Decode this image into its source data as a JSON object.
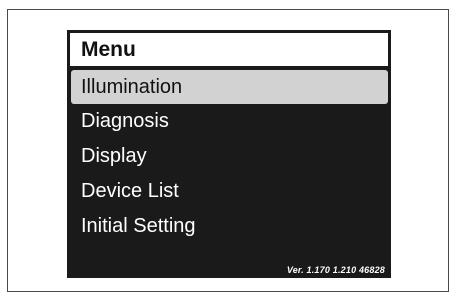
{
  "menu": {
    "title": "Menu",
    "items": [
      {
        "label": "Illumination",
        "selected": true
      },
      {
        "label": "Diagnosis",
        "selected": false
      },
      {
        "label": "Display",
        "selected": false
      },
      {
        "label": "Device List",
        "selected": false
      },
      {
        "label": "Initial Setting",
        "selected": false
      }
    ]
  },
  "footer": {
    "version": "Ver. 1.170  1.210  46828"
  },
  "colors": {
    "screen_background": "#1a1a1a",
    "selection_highlight": "#d2d2d2",
    "title_background": "#ffffff",
    "text_light": "#ffffff",
    "text_dark": "#111111"
  }
}
